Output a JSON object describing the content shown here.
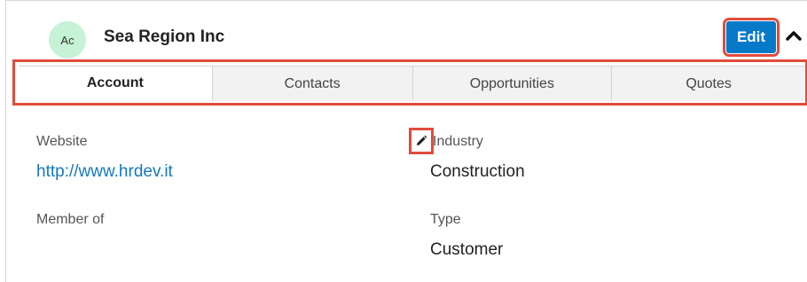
{
  "record": {
    "avatar_initials": "Ac",
    "name": "Sea Region Inc",
    "edit_label": "Edit",
    "collapse_icon": "chevron-up-icon"
  },
  "tabs": [
    {
      "label": "Account",
      "active": true
    },
    {
      "label": "Contacts",
      "active": false
    },
    {
      "label": "Opportunities",
      "active": false
    },
    {
      "label": "Quotes",
      "active": false
    }
  ],
  "fields": {
    "website": {
      "label": "Website",
      "value": "http://www.hrdev.it"
    },
    "member_of": {
      "label": "Member of",
      "value": ""
    },
    "industry": {
      "label": "Industry",
      "value": "Construction",
      "edit_icon": "pencil-icon"
    },
    "type": {
      "label": "Type",
      "value": "Customer"
    }
  },
  "colors": {
    "accent": "#0679c8",
    "highlight": "#e24b3b",
    "avatar_bg": "#c6f2d6",
    "link": "#1378c2"
  }
}
